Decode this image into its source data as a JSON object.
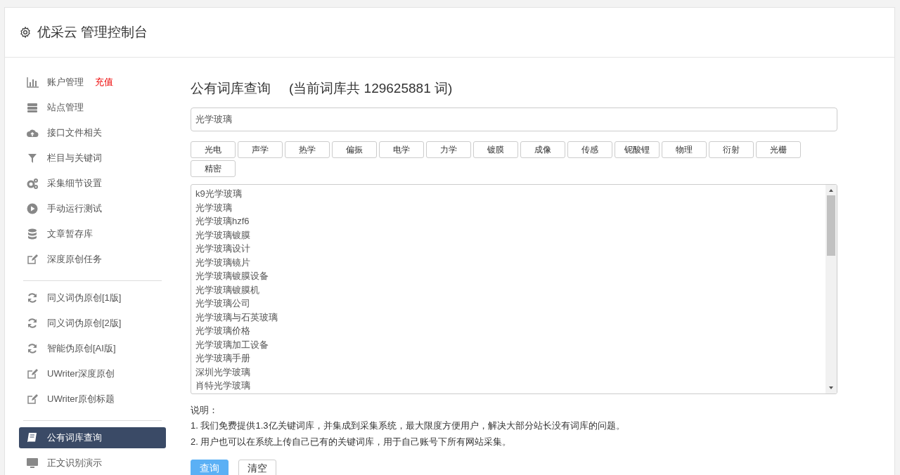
{
  "header": {
    "title": "优采云 管理控制台"
  },
  "sidebar": {
    "groups": [
      {
        "items": [
          {
            "label": "账户管理",
            "badge": "充值",
            "selected": false
          },
          {
            "label": "站点管理",
            "selected": false
          },
          {
            "label": "接口文件相关",
            "selected": false
          },
          {
            "label": "栏目与关键词",
            "selected": false
          },
          {
            "label": "采集细节设置",
            "selected": false
          },
          {
            "label": "手动运行测试",
            "selected": false
          },
          {
            "label": "文章暂存库",
            "selected": false
          },
          {
            "label": "深度原创任务",
            "selected": false
          }
        ]
      },
      {
        "items": [
          {
            "label": "同义词伪原创[1版]",
            "selected": false
          },
          {
            "label": "同义词伪原创[2版]",
            "selected": false
          },
          {
            "label": "智能伪原创[AI版]",
            "selected": false
          },
          {
            "label": "UWriter深度原创",
            "selected": false
          },
          {
            "label": "UWriter原创标题",
            "selected": false
          }
        ]
      },
      {
        "items": [
          {
            "label": "公有词库查询",
            "selected": true
          },
          {
            "label": "正文识别演示",
            "selected": false
          }
        ]
      }
    ]
  },
  "main": {
    "title": "公有词库查询",
    "count_text": "(当前词库共 129625881 词)",
    "search": {
      "value": "光学玻璃"
    },
    "tags": [
      "光电",
      "声学",
      "热学",
      "偏振",
      "电学",
      "力学",
      "镀膜",
      "成像",
      "传感",
      "铌酸锂",
      "物理",
      "衍射",
      "光栅",
      "精密"
    ],
    "results": [
      "k9光学玻璃",
      "光学玻璃",
      "光学玻璃hzf6",
      "光学玻璃镀膜",
      "光学玻璃设计",
      "光学玻璃镜片",
      "光学玻璃镀膜设备",
      "光学玻璃镀膜机",
      "光学玻璃公司",
      "光学玻璃与石英玻璃",
      "光学玻璃价格",
      "光学玻璃加工设备",
      "光学玻璃手册",
      "深圳光学玻璃",
      "肖特光学玻璃"
    ],
    "notes_title": "说明：",
    "notes": [
      "1. 我们免费提供1.3亿关键词库，并集成到采集系统，最大限度方便用户，解决大部分站长没有词库的问题。",
      "2. 用户也可以在系统上传自己已有的关键词库，用于自己账号下所有网站采集。"
    ],
    "buttons": [
      {
        "label": "查询",
        "kind": "primary"
      },
      {
        "label": "清空",
        "kind": "default"
      }
    ]
  }
}
